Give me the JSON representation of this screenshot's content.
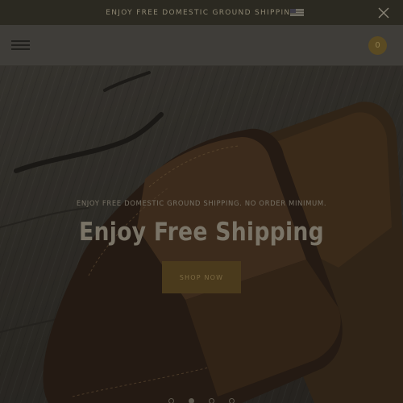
{
  "announcement": {
    "text": "ENJOY FREE DOMESTIC GROUND SHIPPING",
    "flag_icon": "us-flag-icon",
    "close_icon": "close-icon"
  },
  "header": {
    "menu_icon": "hamburger-menu-icon",
    "cart_count": "0"
  },
  "hero": {
    "subtitle": "ENJOY FREE DOMESTIC GROUND SHIPPING. NO ORDER MINIMUM.",
    "title": "Enjoy Free Shipping",
    "cta_label": "SHOP NOW",
    "slides": 4,
    "active_slide": 1
  },
  "colors": {
    "announcement_bg": "#2b2921",
    "header_bg": "#3f3d39",
    "cta_bg": "#4a3a1c",
    "accent": "#5a4a22"
  }
}
